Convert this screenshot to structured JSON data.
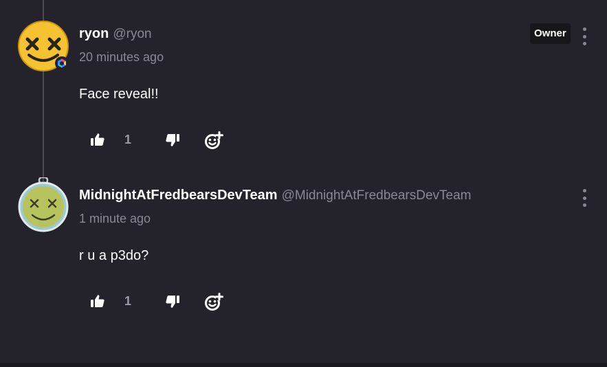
{
  "comments": [
    {
      "username": "ryon",
      "handle": "@ryon",
      "timestamp": "20 minutes ago",
      "text": "Face reveal!!",
      "badge": "Owner",
      "likes": "1",
      "avatar_icon": "yellow-x-eyes-smiley",
      "avatar_color": "#f5c331",
      "verified_icon": "rainbow-hexagon-icon"
    },
    {
      "username": "MidnightAtFredbearsDevTeam",
      "handle": "@MidnightAtFredbearsDevTeam",
      "timestamp": "1 minute ago",
      "text": "r u a p3do?",
      "likes": "1",
      "avatar_icon": "green-x-eyes-smiley-keychain",
      "avatar_color": "#b7c45d"
    }
  ],
  "icons": {
    "like": "thumbs-up-icon",
    "dislike": "thumbs-down-icon",
    "react": "add-reaction-icon",
    "more": "more-vertical-icon"
  },
  "colors": {
    "background": "#24222a",
    "text": "#ffffff",
    "muted": "#8a8893",
    "badge_bg": "#17161b"
  }
}
